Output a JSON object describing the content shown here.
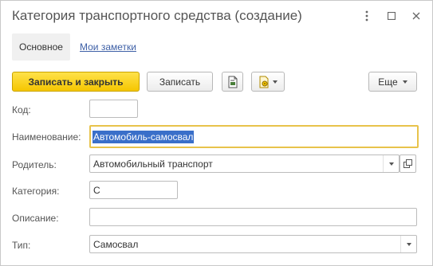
{
  "window": {
    "title": "Категория транспортного средства (создание)"
  },
  "tabs": [
    {
      "label": "Основное",
      "active": true
    },
    {
      "label": "Мои заметки",
      "active": false
    }
  ],
  "toolbar": {
    "save_close_label": "Записать и закрыть",
    "save_label": "Записать",
    "more_label": "Еще"
  },
  "form": {
    "code": {
      "label": "Код:",
      "value": ""
    },
    "name": {
      "label": "Наименование:",
      "value": "Автомобиль-самосвал"
    },
    "parent": {
      "label": "Родитель:",
      "value": "Автомобильный транспорт"
    },
    "category": {
      "label": "Категория:",
      "value": "С"
    },
    "description": {
      "label": "Описание:",
      "value": ""
    },
    "type": {
      "label": "Тип:",
      "value": "Самосвал"
    }
  },
  "colors": {
    "accent_yellow": "#f5c600",
    "focus_border": "#e8c34b",
    "selection": "#3a6fc9",
    "link": "#3d5fa6"
  }
}
